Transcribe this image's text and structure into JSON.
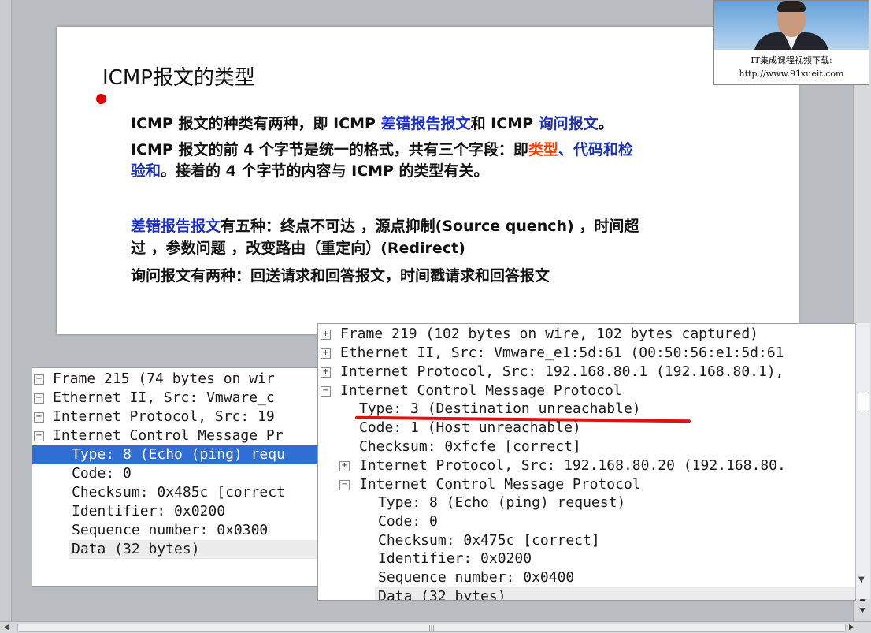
{
  "slide": {
    "title": "ICMP报文的类型",
    "p1": {
      "a": "ICMP 报文的种类有两种，即 ICMP ",
      "b": "差错报告报文",
      "c": "和 ICMP ",
      "d": "询问报文",
      "e": "。"
    },
    "p2": {
      "a": "ICMP 报文的前 4 个字节是统一的格式，共有三个字段：即",
      "b": "类型",
      "c": "、",
      "d": "代码和检",
      "e": "验和",
      "f": "。接着的 4 个字节的内容与 ICMP 的类型有关。"
    },
    "p3": {
      "a": "差错报告报文",
      "b": "有五种：终点不可达 ，源点抑制(Source quench) ，时间超",
      "c": "过 ，参数问题 ，改变路由（重定向）(Redirect)"
    },
    "p4": "询问报文有两种：回送请求和回答报文，时间戳请求和回答报文"
  },
  "presenter": {
    "line1": "IT集成课程视频下载:",
    "line2": "http://www.91xueit.com"
  },
  "left_pane": {
    "rows": [
      "Frame 215 (74 bytes on wir",
      "Ethernet II, Src: Vmware_c",
      "Internet Protocol, Src: 19",
      "Internet Control Message Pr",
      "Type: 8 (Echo (ping) requ",
      "Code: 0",
      "Checksum: 0x485c [correct",
      "Identifier: 0x0200",
      "Sequence number: 0x0300",
      "Data (32 bytes)"
    ]
  },
  "right_pane": {
    "rows": [
      "Frame 219 (102 bytes on wire, 102 bytes captured)",
      "Ethernet II, Src: Vmware_e1:5d:61 (00:50:56:e1:5d:61",
      "Internet Protocol, Src: 192.168.80.1 (192.168.80.1),",
      "Internet Control Message Protocol",
      "Type: 3 (Destination unreachable)",
      "Code: 1 (Host unreachable)",
      "Checksum: 0xfcfe [correct]",
      "Internet Protocol, Src: 192.168.80.20 (192.168.80.",
      "Internet Control Message Protocol",
      "Type: 8 (Echo (ping) request)",
      "Code: 0",
      "Checksum: 0x475c [correct]",
      "Identifier: 0x0200",
      "Sequence number: 0x0400",
      "Data (32 bytes)"
    ]
  },
  "colors": {
    "highlight": "#2f6fd3",
    "underline": "#e01010",
    "bullet": "#e00000",
    "blue_text": "#1b2fd0",
    "orange_text": "#ff3b00"
  },
  "icons": {
    "expand": "plus-box",
    "collapse": "minus-box"
  }
}
